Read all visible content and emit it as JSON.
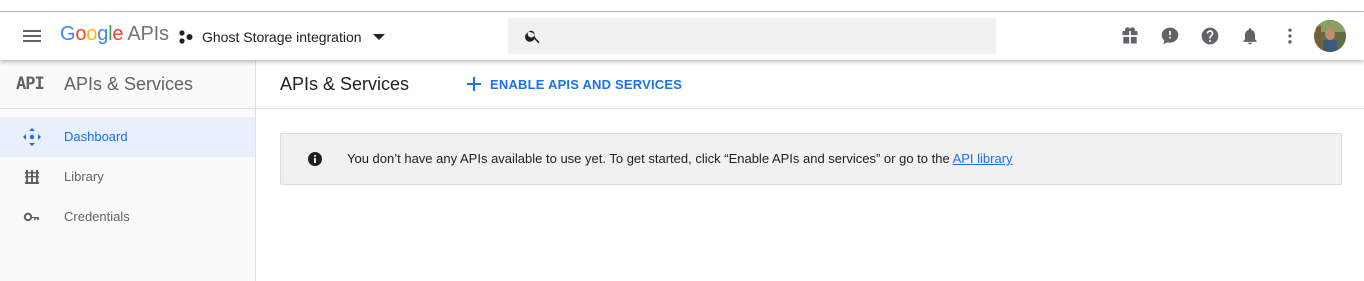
{
  "header": {
    "logo_google": "Google",
    "logo_apis": "APIs",
    "project_name": "Ghost Storage integration",
    "search_placeholder": "",
    "icons": [
      "menu-icon",
      "gift-icon",
      "feedback-icon",
      "help-icon",
      "notifications-icon",
      "more-vert-icon"
    ]
  },
  "sidebar": {
    "badge": "API",
    "title": "APIs & Services",
    "items": [
      {
        "label": "Dashboard",
        "icon": "dashboard-icon",
        "active": true
      },
      {
        "label": "Library",
        "icon": "library-icon",
        "active": false
      },
      {
        "label": "Credentials",
        "icon": "key-icon",
        "active": false
      }
    ]
  },
  "main": {
    "title": "APIs & Services",
    "enable_button": "ENABLE APIS AND SERVICES",
    "info_text": "You don’t have any APIs available to use yet. To get started, click “Enable APIs and services” or go to the ",
    "info_link": "API library"
  },
  "colors": {
    "accent": "#1a73e8",
    "active_bg": "#e8f0fe",
    "sidebar_bg": "#fafafa",
    "info_bg": "#f1f1f1"
  }
}
